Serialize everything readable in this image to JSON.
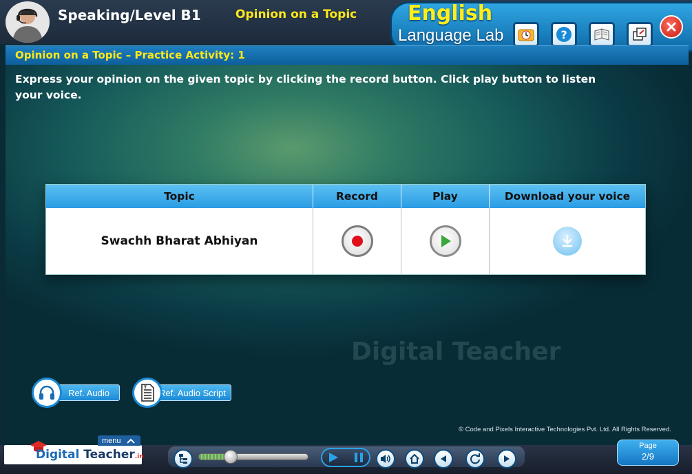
{
  "header": {
    "title": "Speaking/Level B1",
    "topic": "Opinion on a Topic",
    "brand_top": "English",
    "brand_bottom": "Language Lab",
    "buttons": [
      {
        "icon": "clock-icon"
      },
      {
        "icon": "help-icon"
      },
      {
        "icon": "book-icon"
      },
      {
        "icon": "restore-window-icon"
      }
    ],
    "close_icon": "close-icon"
  },
  "subbar": {
    "title": "Opinion on a Topic – Practice Activity: 1"
  },
  "instruction": "Express your opinion on the given topic by clicking the record button. Click play button to listen your voice.",
  "table": {
    "headers": [
      "Topic",
      "Record",
      "Play",
      "Download your voice"
    ],
    "rows": [
      {
        "topic": "Swachh Bharat Abhiyan",
        "record_icon": "record-icon",
        "play_icon": "play-icon",
        "download_icon": "download-icon"
      }
    ]
  },
  "watermark": "Digital Teacher",
  "ref_buttons": {
    "audio": "Ref. Audio",
    "script": "Ref. Audio Script"
  },
  "copyright": "© Code and Pixels Interactive Technologies  Pvt. Ltd. All Rights Reserved.",
  "footer": {
    "logo_main": "Digital",
    "logo_teacher": "Teacher",
    "logo_suffix": ".in",
    "menu_label": "menu",
    "progress": 0.3,
    "page_label": "Page",
    "page_value": "2/9"
  },
  "colors": {
    "accent_yellow": "#ffe81a",
    "brand_blue": "#1a8ad6",
    "record_red": "#e0101a",
    "play_green": "#3aa83a"
  }
}
